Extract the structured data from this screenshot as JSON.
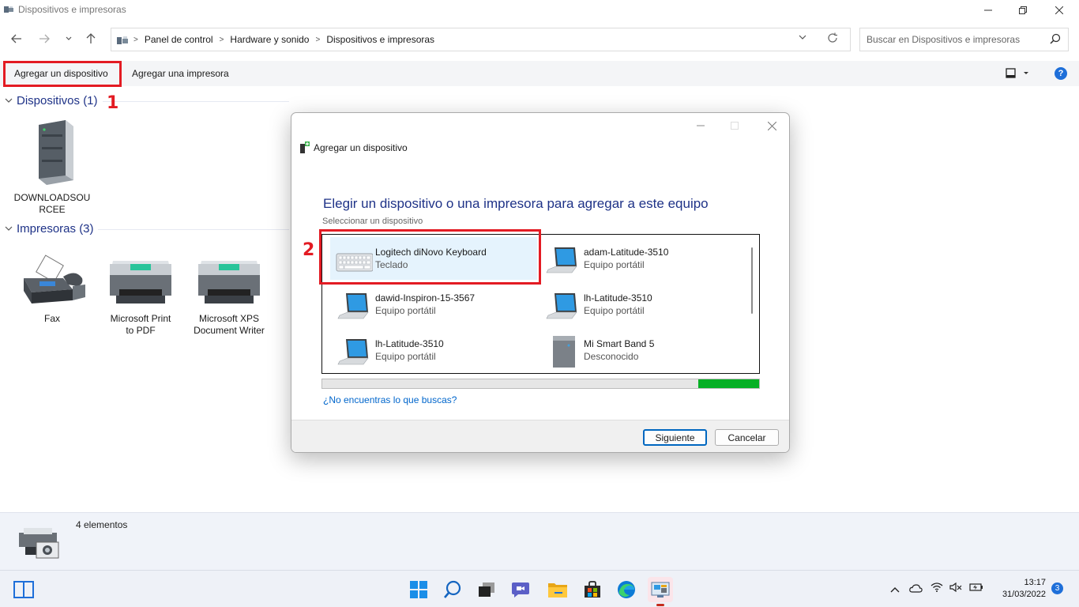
{
  "window": {
    "title": "Dispositivos e impresoras",
    "minimize_icon": "minimize-icon",
    "maximize_icon": "restore-icon",
    "close_icon": "close-icon"
  },
  "nav": {
    "back_icon": "back-arrow-icon",
    "forward_icon": "forward-arrow-icon",
    "recent_icon": "chevron-down-icon",
    "up_icon": "up-arrow-icon"
  },
  "address": {
    "crumbs": [
      "Panel de control",
      "Hardware y sonido",
      "Dispositivos e impresoras"
    ],
    "separator": ">",
    "dropdown_icon": "chevron-down-icon",
    "refresh_icon": "refresh-icon"
  },
  "search": {
    "placeholder": "Buscar en Dispositivos e impresoras",
    "icon": "search-icon"
  },
  "commands": {
    "add_device": "Agregar un dispositivo",
    "add_printer": "Agregar una impresora",
    "view_icon": "view-options-icon",
    "help": "?"
  },
  "annotations": {
    "step1": "1",
    "step2": "2",
    "highlight_color": "#e31b23"
  },
  "groups": {
    "devices": {
      "header": "Dispositivos (1)",
      "items": [
        {
          "label_line1": "DOWNLOADSOU",
          "label_line2": "RCEE",
          "icon": "computer-tower-icon"
        }
      ]
    },
    "printers": {
      "header": "Impresoras (3)",
      "items": [
        {
          "label_line1": "Fax",
          "label_line2": "",
          "icon": "fax-icon"
        },
        {
          "label_line1": "Microsoft Print",
          "label_line2": "to PDF",
          "icon": "printer-icon"
        },
        {
          "label_line1": "Microsoft XPS",
          "label_line2": "Document Writer",
          "icon": "printer-icon"
        }
      ]
    }
  },
  "details": {
    "count": "4 elementos",
    "icon": "devices-printers-icon"
  },
  "dialog": {
    "title": "Agregar un dispositivo",
    "heading": "Elegir un dispositivo o una impresora para agregar a este equipo",
    "subheading": "Seleccionar un dispositivo",
    "devices": [
      {
        "name": "Logitech diNovo Keyboard",
        "type": "Teclado",
        "icon": "keyboard-icon",
        "selected": true
      },
      {
        "name": "adam-Latitude-3510",
        "type": "Equipo portátil",
        "icon": "laptop-icon",
        "selected": false
      },
      {
        "name": "dawid-Inspiron-15-3567",
        "type": "Equipo portátil",
        "icon": "laptop-icon",
        "selected": false
      },
      {
        "name": "lh-Latitude-3510",
        "type": "Equipo portátil",
        "icon": "laptop-icon",
        "selected": false
      },
      {
        "name": "lh-Latitude-3510",
        "type": "Equipo portátil",
        "icon": "laptop-icon",
        "selected": false
      },
      {
        "name": "Mi Smart Band 5",
        "type": "Desconocido",
        "icon": "unknown-device-icon",
        "selected": false
      }
    ],
    "progress_indeterminate": true,
    "link": "¿No encuentras lo que buscas?",
    "next": "Siguiente",
    "cancel": "Cancelar",
    "accent": "#0067c0",
    "progress_color": "#06b025"
  },
  "taskbar": {
    "apps": [
      "start-icon",
      "search-icon",
      "task-view-icon",
      "chat-icon",
      "file-explorer-icon",
      "store-icon",
      "edge-icon",
      "control-panel-icon"
    ],
    "tray": [
      "chevron-up-icon",
      "onedrive-cloud-icon",
      "wifi-icon",
      "speaker-muted-icon",
      "battery-icon"
    ],
    "time": "13:17",
    "date": "31/03/2022",
    "notifications": "3"
  }
}
